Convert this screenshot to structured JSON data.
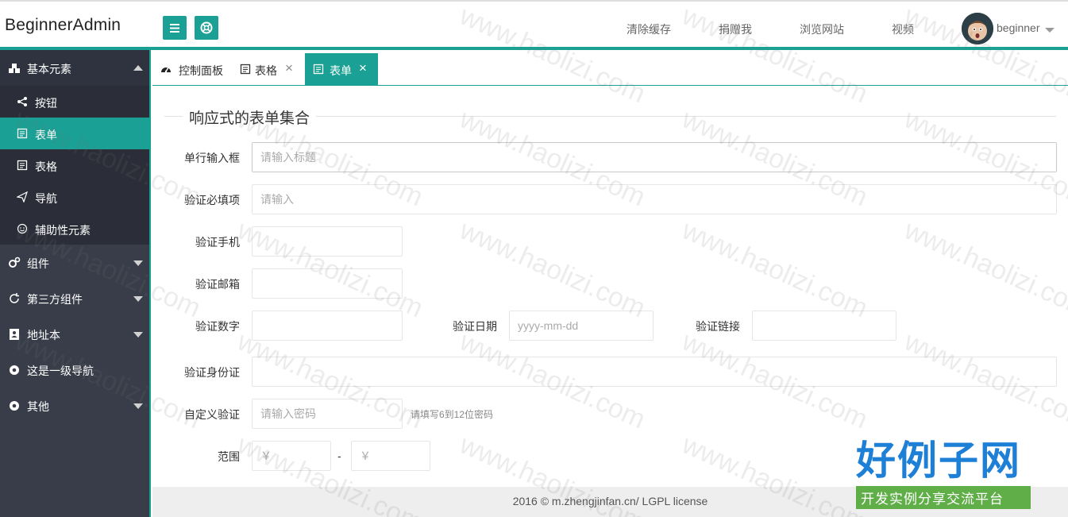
{
  "header": {
    "logo": "BeginnerAdmin",
    "menu_button_icon": "menu-icon",
    "globe_button_icon": "lifebuoy-icon",
    "links": [
      "清除缓存",
      "捐赠我",
      "浏览网站",
      "视频"
    ],
    "user_name": "beginner"
  },
  "sidebar": {
    "groups": [
      {
        "label": "基本元素",
        "icon": "cubes-icon",
        "expanded": true
      },
      {
        "label": "组件",
        "icon": "gears-icon"
      },
      {
        "label": "第三方组件",
        "icon": "refresh-icon"
      },
      {
        "label": "地址本",
        "icon": "address-book-icon"
      },
      {
        "label": "这是一级导航",
        "icon": "dot-circle-icon"
      },
      {
        "label": "其他",
        "icon": "dot-circle-icon"
      }
    ],
    "sub_items": [
      {
        "label": "按钮",
        "icon": "share-icon"
      },
      {
        "label": "表单",
        "icon": "form-icon",
        "active": true
      },
      {
        "label": "表格",
        "icon": "table-icon"
      },
      {
        "label": "导航",
        "icon": "paper-plane-icon"
      },
      {
        "label": "辅助性元素",
        "icon": "smile-icon"
      }
    ]
  },
  "tabs": [
    {
      "label": "控制面板",
      "icon": "dashboard-icon",
      "closable": false
    },
    {
      "label": "表格",
      "icon": "table-icon",
      "closable": true
    },
    {
      "label": "表单",
      "icon": "form-icon",
      "closable": true,
      "active": true
    }
  ],
  "form": {
    "legend": "响应式的表单集合",
    "fields": {
      "title": {
        "label": "单行输入框",
        "placeholder": "请输入标题"
      },
      "required": {
        "label": "验证必填项",
        "placeholder": "请输入"
      },
      "phone": {
        "label": "验证手机",
        "placeholder": ""
      },
      "email": {
        "label": "验证邮箱",
        "placeholder": ""
      },
      "number": {
        "label": "验证数字",
        "placeholder": ""
      },
      "date": {
        "label": "验证日期",
        "placeholder": "yyyy-mm-dd"
      },
      "url": {
        "label": "验证链接",
        "placeholder": ""
      },
      "identity": {
        "label": "验证身份证",
        "placeholder": ""
      },
      "password": {
        "label": "自定义验证",
        "placeholder": "请输入密码",
        "hint": "请填写6到12位密码"
      },
      "range": {
        "label": "范围",
        "min_placeholder": "￥",
        "max_placeholder": "￥",
        "separator": "-"
      }
    }
  },
  "footer": {
    "text": "2016 ©  m.zhengjinfan.cn/  LGPL license"
  },
  "watermark": {
    "text": "www.haolizi.com",
    "brand_top": "好例子网",
    "brand_bottom": "开发实例分享交流平台"
  },
  "colors": {
    "accent": "#1aa094",
    "sidebar_bg": "#393d49",
    "sidebar_sub_bg": "#2b2e38",
    "brand_blue": "#1e7fd6",
    "brand_green": "#5fae47"
  }
}
